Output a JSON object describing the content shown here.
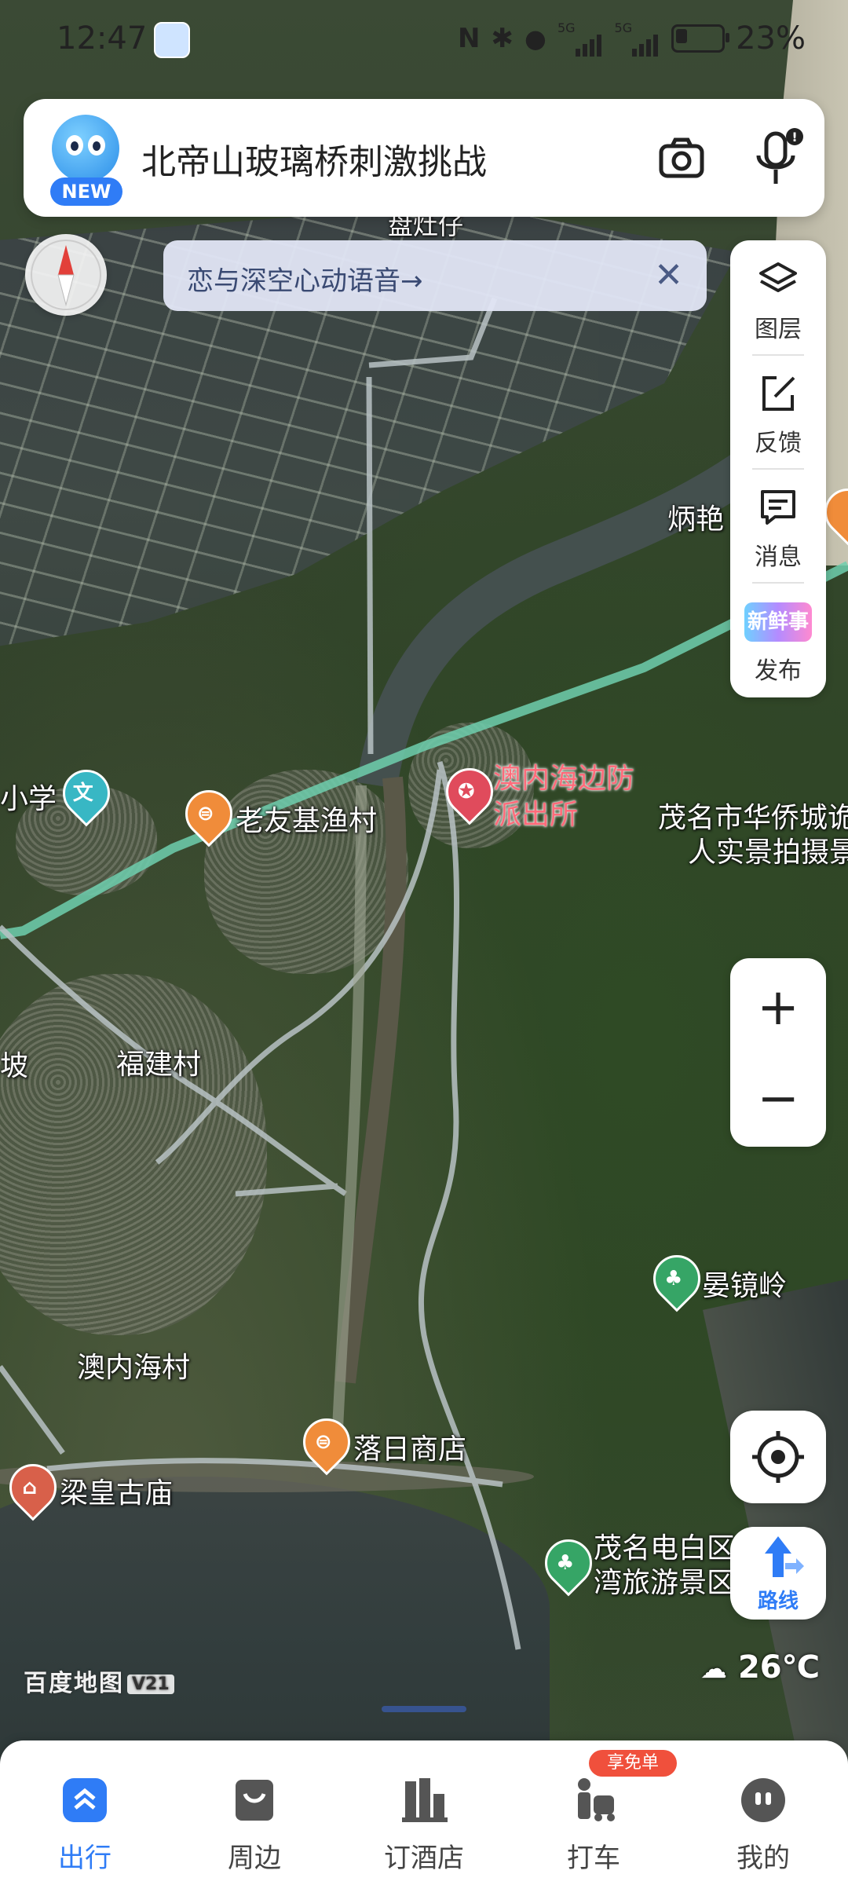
{
  "status_bar": {
    "time": "12:47",
    "network": "5G",
    "network2": "5G",
    "battery": "23%",
    "icons": [
      "nfc-icon",
      "bluetooth-icon",
      "location-icon",
      "signal-icon",
      "signal-icon",
      "battery-icon"
    ]
  },
  "search": {
    "query": "北帝山玻璃桥刺激挑战",
    "new_badge": "NEW",
    "camera_icon": "camera-icon",
    "mic_icon": "microphone-icon"
  },
  "banner": {
    "text": "恋与深空心动语音→",
    "close": "✕"
  },
  "tools": [
    {
      "label": "图层",
      "icon": "layers-icon"
    },
    {
      "label": "反馈",
      "icon": "edit-icon"
    },
    {
      "label": "消息",
      "icon": "message-icon"
    },
    {
      "label": "发布",
      "icon": "fresh-news-icon",
      "badge": "新鲜事"
    }
  ],
  "zoom": {
    "in": "+",
    "out": "−"
  },
  "route_label": "路线",
  "map_labels": {
    "top_partial": "盘灶仔",
    "right_partial": "炳艳",
    "primary_school": "小学",
    "fishing_village": "老友基渔村",
    "police_line1": "澳内海边防",
    "police_line2": "派出所",
    "overseas_line1": "茂名市华侨城诡",
    "overseas_line2": "人实景拍摄景",
    "left_partial": "坡",
    "fujian": "福建村",
    "yanjing": "晏镜岭",
    "aoneihai": "澳内海村",
    "sunset_shop": "落日商店",
    "temple": "梁皇古庙",
    "scenic_line1": "茂名电白区",
    "scenic_line2": "湾旅游景区"
  },
  "watermark": {
    "text": "百度地图",
    "version": "V21"
  },
  "weather": {
    "temp": "26℃",
    "icon": "rain-cloud-icon"
  },
  "nav": [
    {
      "label": "出行",
      "icon": "travel-icon",
      "active": true
    },
    {
      "label": "周边",
      "icon": "nearby-icon",
      "active": false
    },
    {
      "label": "订酒店",
      "icon": "hotel-icon",
      "active": false
    },
    {
      "label": "打车",
      "icon": "taxi-icon",
      "active": false
    },
    {
      "label": "我的",
      "icon": "profile-icon",
      "active": false
    }
  ],
  "nav_promo": "享免单"
}
